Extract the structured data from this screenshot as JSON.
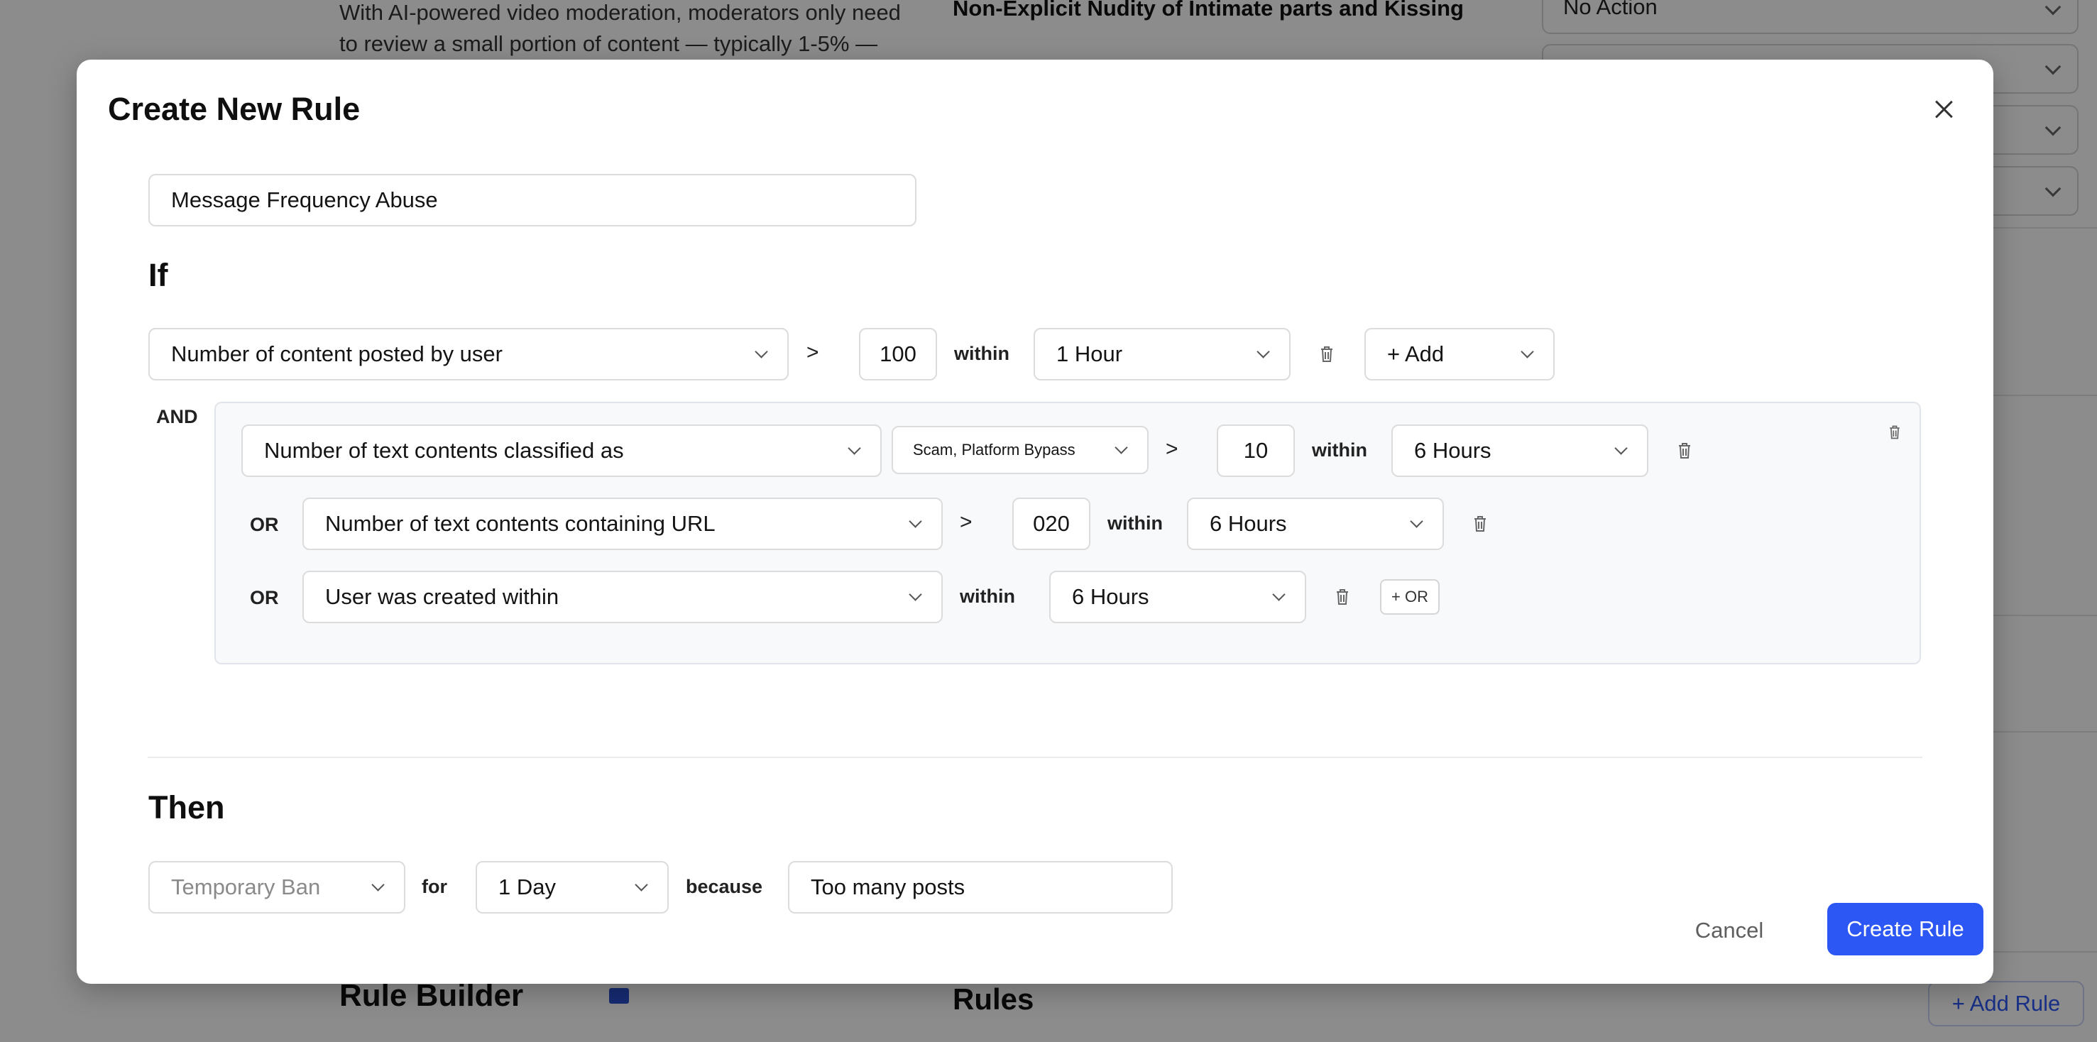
{
  "background": {
    "intro_text": "With AI-powered video moderation, moderators only need to review a small portion of content — typically 1-5% —",
    "category_label": "Non-Explicit Nudity of Intimate parts and Kissing",
    "action_select": "No Action",
    "rule_builder_heading": "Rule Builder",
    "rules_heading": "Rules",
    "add_rule_button": "+ Add Rule"
  },
  "modal": {
    "title": "Create New Rule",
    "rule_name_value": "Message Frequency Abuse",
    "if_label": "If",
    "then_label": "Then",
    "and_label": "AND",
    "or_label": "OR",
    "within_label": "within",
    "gt_symbol": ">",
    "condition1": {
      "metric": "Number of content posted by user",
      "threshold": "100",
      "period": "1 Hour",
      "add_button": "+ Add"
    },
    "group": {
      "row1": {
        "metric": "Number of text contents classified as",
        "classes": "Scam, Platform Bypass",
        "threshold": "10",
        "period": "6 Hours"
      },
      "row2": {
        "metric": "Number of text contents containing URL",
        "threshold": "020",
        "period": "6 Hours"
      },
      "row3": {
        "metric": "User was created within",
        "period": "6 Hours",
        "add_or_button": "+ OR"
      }
    },
    "action": {
      "type": "Temporary Ban",
      "for_label": "for",
      "duration": "1 Day",
      "because_label": "because",
      "reason": "Too many posts"
    },
    "cancel_button": "Cancel",
    "create_button": "Create Rule"
  },
  "colors": {
    "primary": "#2d57f5",
    "overlay": "rgba(0,0,0,0.45)"
  }
}
